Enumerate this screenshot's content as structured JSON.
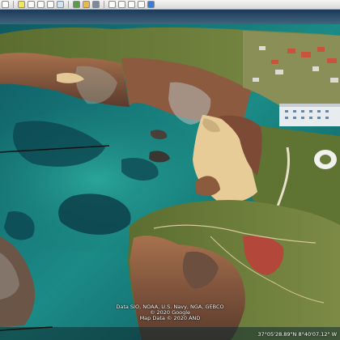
{
  "toolbar": {
    "buttons": [
      "sidebar-toggle",
      "placemark",
      "polygon",
      "path",
      "image-overlay",
      "record-tour",
      "historical-imagery",
      "sunlight",
      "planets",
      "ruler",
      "email",
      "print",
      "save-image",
      "view-in-maps"
    ]
  },
  "map": {
    "attribution": {
      "line1": "Data SIO, NOAA, U.S. Navy, NGA, GEBCO",
      "line2": "© 2020 Google",
      "line3": "Map Data © 2020 AND"
    },
    "coordinates": "37°05'28.89\"N    8°40'07.12\" W"
  },
  "colors": {
    "sea_deep": "#0a4d55",
    "sea_shallow": "#1f8a84",
    "cliff": "#8a5a42",
    "vegetation": "#6b7b3a",
    "sand": "#e7cc98"
  }
}
